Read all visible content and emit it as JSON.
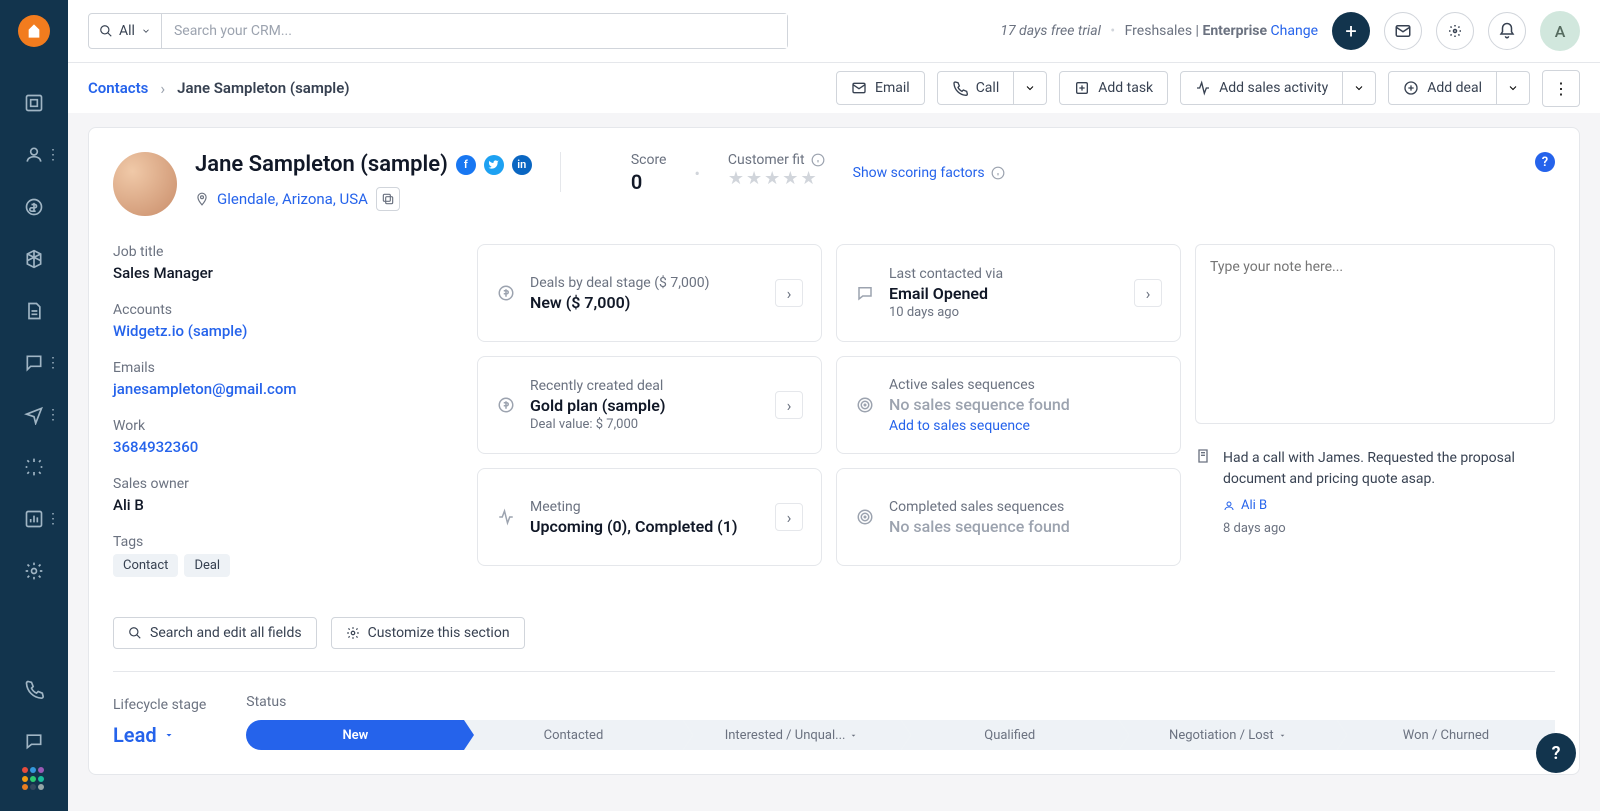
{
  "topbar": {
    "search_all": "All",
    "search_placeholder": "Search your CRM...",
    "trial": "17 days free trial",
    "product": "Freshsales",
    "plan": "Enterprise",
    "change": "Change",
    "avatar_initial": "A"
  },
  "crumbs": {
    "root": "Contacts",
    "current": "Jane Sampleton (sample)",
    "email": "Email",
    "call": "Call",
    "add_task": "Add task",
    "add_activity": "Add sales activity",
    "add_deal": "Add deal"
  },
  "header": {
    "name": "Jane Sampleton (sample)",
    "location": "Glendale, Arizona, USA",
    "score_label": "Score",
    "score_value": "0",
    "fit_label": "Customer fit",
    "scoring_link": "Show scoring factors"
  },
  "fields": {
    "job_title_label": "Job title",
    "job_title": "Sales Manager",
    "accounts_label": "Accounts",
    "accounts": "Widgetz.io (sample)",
    "emails_label": "Emails",
    "emails": "janesampleton@gmail.com",
    "work_label": "Work",
    "work": "3684932360",
    "owner_label": "Sales owner",
    "owner": "Ali B",
    "tags_label": "Tags",
    "tag1": "Contact",
    "tag2": "Deal"
  },
  "cards": {
    "deals_title": "Deals by deal stage ($ 7,000)",
    "deals_value": "New ($ 7,000)",
    "recent_title": "Recently created deal",
    "recent_value": "Gold plan (sample)",
    "recent_sub": "Deal value: $ 7,000",
    "meeting_title": "Meeting",
    "meeting_value": "Upcoming (0), Completed (1)",
    "contacted_title": "Last contacted via",
    "contacted_value": "Email Opened",
    "contacted_sub": "10 days ago",
    "active_seq_title": "Active sales sequences",
    "active_seq_value": "No sales sequence found",
    "active_seq_link": "Add to sales sequence",
    "completed_seq_title": "Completed sales sequences",
    "completed_seq_value": "No sales sequence found"
  },
  "notes": {
    "placeholder": "Type your note here...",
    "text": "Had a call with James. Requested the proposal document and pricing quote asap.",
    "author": "Ali B",
    "time": "8 days ago"
  },
  "actions": {
    "search_edit": "Search and edit all fields",
    "customize": "Customize this section"
  },
  "lifecycle": {
    "stage_label": "Lifecycle stage",
    "stage_value": "Lead",
    "status_label": "Status",
    "stages": {
      "s1": "New",
      "s2": "Contacted",
      "s3": "Interested / Unqual...",
      "s4": "Qualified",
      "s5": "Negotiation / Lost",
      "s6": "Won / Churned"
    }
  }
}
